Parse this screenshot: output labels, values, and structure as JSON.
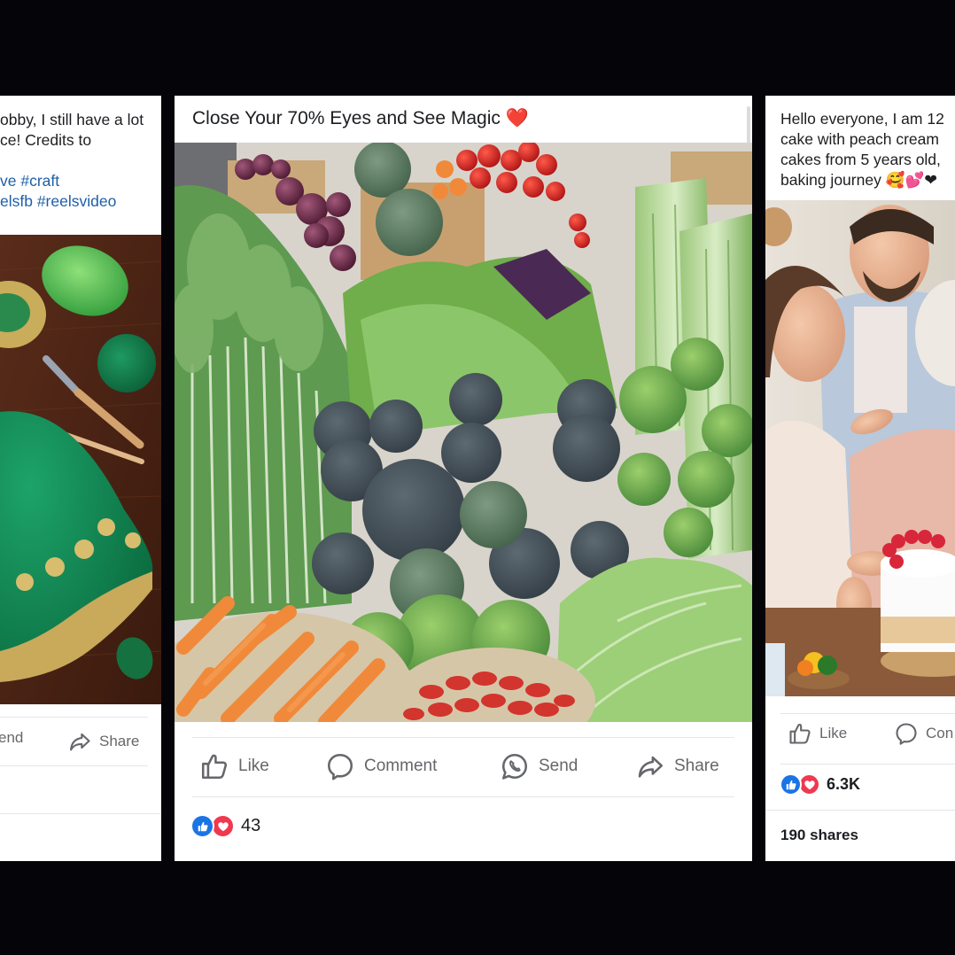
{
  "posts": [
    {
      "id": "left",
      "caption_lines": [
        "obby, I still have a lot",
        "ce! Credits to",
        "",
        "ve #craft",
        "elsfb #reelsvideo"
      ],
      "image": "crochet-green-dress-with-yarn-balls-and-hooks",
      "actions": {
        "send": "end",
        "share": "Share"
      }
    },
    {
      "id": "center",
      "caption": "Close Your 70% Eyes and See Magic",
      "caption_emoji": "❤️",
      "image": "vegetable-market-broccoli-greens-carrots",
      "actions": {
        "like": "Like",
        "comment": "Comment",
        "send": "Send",
        "share": "Share"
      },
      "reactions": {
        "types": [
          "like",
          "love"
        ],
        "count": "43"
      }
    },
    {
      "id": "right",
      "caption_lines": [
        "Hello everyone, I am 12",
        "cake with peach cream",
        "cakes from 5 years old,",
        "baking journey 🥰💕❤"
      ],
      "image": "family-celebrating-with-birthday-cake",
      "actions": {
        "like": "Like",
        "comment": "Con"
      },
      "reactions": {
        "types": [
          "like",
          "love"
        ],
        "count": "6.3K"
      },
      "shares": "190 shares"
    }
  ],
  "colors": {
    "background": "#050509",
    "card": "#ffffff",
    "hashtag": "#1e5fa8",
    "action_gray": "#65676b",
    "like_blue": "#1b74e4",
    "love_red": "#f0384f"
  }
}
